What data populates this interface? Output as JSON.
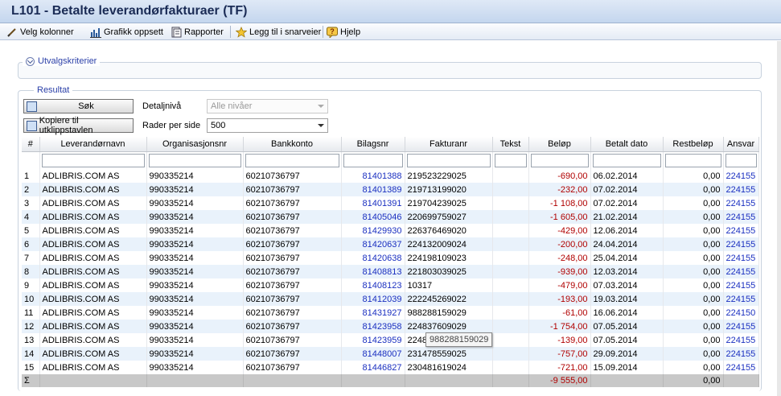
{
  "window": {
    "title": "L101 - Betalte leverandørfakturaer (TF)"
  },
  "toolbar": {
    "items": [
      {
        "label": "Velg kolonner",
        "icon": "pencil-icon"
      },
      {
        "label": "Grafikk oppsett",
        "icon": "bar-chart-icon"
      },
      {
        "label": "Rapporter",
        "icon": "report-icon"
      },
      {
        "label": "Legg til i snarveier",
        "icon": "star-icon"
      },
      {
        "label": "Hjelp",
        "icon": "help-icon"
      }
    ]
  },
  "criteria": {
    "legend": "Utvalgskriterier"
  },
  "result": {
    "legend": "Resultat",
    "search_button": "Søk",
    "copy_button": "Kopiere til utklippstavlen",
    "detail_label": "Detaljnivå",
    "detail_value": "Alle nivåer",
    "rows_label": "Rader per side",
    "rows_value": "500"
  },
  "table": {
    "columns": [
      "#",
      "Leverandørnavn",
      "Organisasjonsnr",
      "Bankkonto",
      "Bilagsnr",
      "Fakturanr",
      "Tekst",
      "Beløp",
      "Betalt dato",
      "Restbeløp",
      "Ansvar"
    ],
    "rows": [
      [
        "1",
        "ADLIBRIS.COM AS",
        "990335214",
        "60210736797",
        "81401388",
        "219523229025",
        "",
        "-690,00",
        "06.02.2014",
        "0,00",
        "224155"
      ],
      [
        "2",
        "ADLIBRIS.COM AS",
        "990335214",
        "60210736797",
        "81401389",
        "219713199020",
        "",
        "-232,00",
        "07.02.2014",
        "0,00",
        "224155"
      ],
      [
        "3",
        "ADLIBRIS.COM AS",
        "990335214",
        "60210736797",
        "81401391",
        "219704239025",
        "",
        "-1 108,00",
        "07.02.2014",
        "0,00",
        "224155"
      ],
      [
        "4",
        "ADLIBRIS.COM AS",
        "990335214",
        "60210736797",
        "81405046",
        "220699759027",
        "",
        "-1 605,00",
        "21.02.2014",
        "0,00",
        "224155"
      ],
      [
        "5",
        "ADLIBRIS.COM AS",
        "990335214",
        "60210736797",
        "81429930",
        "226376469020",
        "",
        "-429,00",
        "12.06.2014",
        "0,00",
        "224155"
      ],
      [
        "6",
        "ADLIBRIS.COM AS",
        "990335214",
        "60210736797",
        "81420637",
        "224132009024",
        "",
        "-200,00",
        "24.04.2014",
        "0,00",
        "224155"
      ],
      [
        "7",
        "ADLIBRIS.COM AS",
        "990335214",
        "60210736797",
        "81420638",
        "224198109023",
        "",
        "-248,00",
        "25.04.2014",
        "0,00",
        "224155"
      ],
      [
        "8",
        "ADLIBRIS.COM AS",
        "990335214",
        "60210736797",
        "81408813",
        "221803039025",
        "",
        "-939,00",
        "12.03.2014",
        "0,00",
        "224155"
      ],
      [
        "9",
        "ADLIBRIS.COM AS",
        "990335214",
        "60210736797",
        "81408123",
        "10317",
        "",
        "-479,00",
        "07.03.2014",
        "0,00",
        "224155"
      ],
      [
        "10",
        "ADLIBRIS.COM AS",
        "990335214",
        "60210736797",
        "81412039",
        "222245269022",
        "",
        "-193,00",
        "19.03.2014",
        "0,00",
        "224155"
      ],
      [
        "11",
        "ADLIBRIS.COM AS",
        "990335214",
        "60210736797",
        "81431927",
        "988288159029",
        "",
        "-61,00",
        "16.06.2014",
        "0,00",
        "224150"
      ],
      [
        "12",
        "ADLIBRIS.COM AS",
        "990335214",
        "60210736797",
        "81423958",
        "224837609029",
        "",
        "-1 754,00",
        "07.05.2014",
        "0,00",
        "224155"
      ],
      [
        "13",
        "ADLIBRIS.COM AS",
        "990335214",
        "60210736797",
        "81423959",
        "224868",
        "",
        "-139,00",
        "07.05.2014",
        "0,00",
        "224155"
      ],
      [
        "14",
        "ADLIBRIS.COM AS",
        "990335214",
        "60210736797",
        "81448007",
        "231478559025",
        "",
        "-757,00",
        "29.09.2014",
        "0,00",
        "224155"
      ],
      [
        "15",
        "ADLIBRIS.COM AS",
        "990335214",
        "60210736797",
        "81446827",
        "230481619024",
        "",
        "-721,00",
        "15.09.2014",
        "0,00",
        "224155"
      ]
    ],
    "sum": {
      "symbol": "Σ",
      "amount": "-9 555,00",
      "rest": "0,00"
    }
  },
  "tooltip": {
    "text": "988288159029"
  }
}
